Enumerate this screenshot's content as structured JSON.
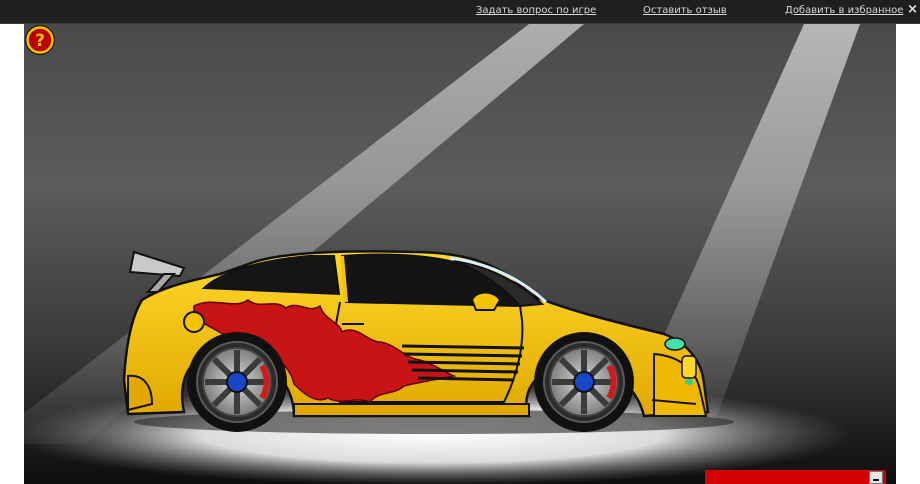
{
  "header": {
    "links": [
      {
        "label": "Задать вопрос по игре"
      },
      {
        "label": "Оставить отзыв"
      },
      {
        "label": "Добавить в избранное"
      }
    ],
    "close_glyph": "×"
  },
  "game": {
    "help_icon_glyph": "?",
    "car_body_color": "#f5c400",
    "flame_color": "#c81414",
    "accent_color": "#d40000"
  }
}
